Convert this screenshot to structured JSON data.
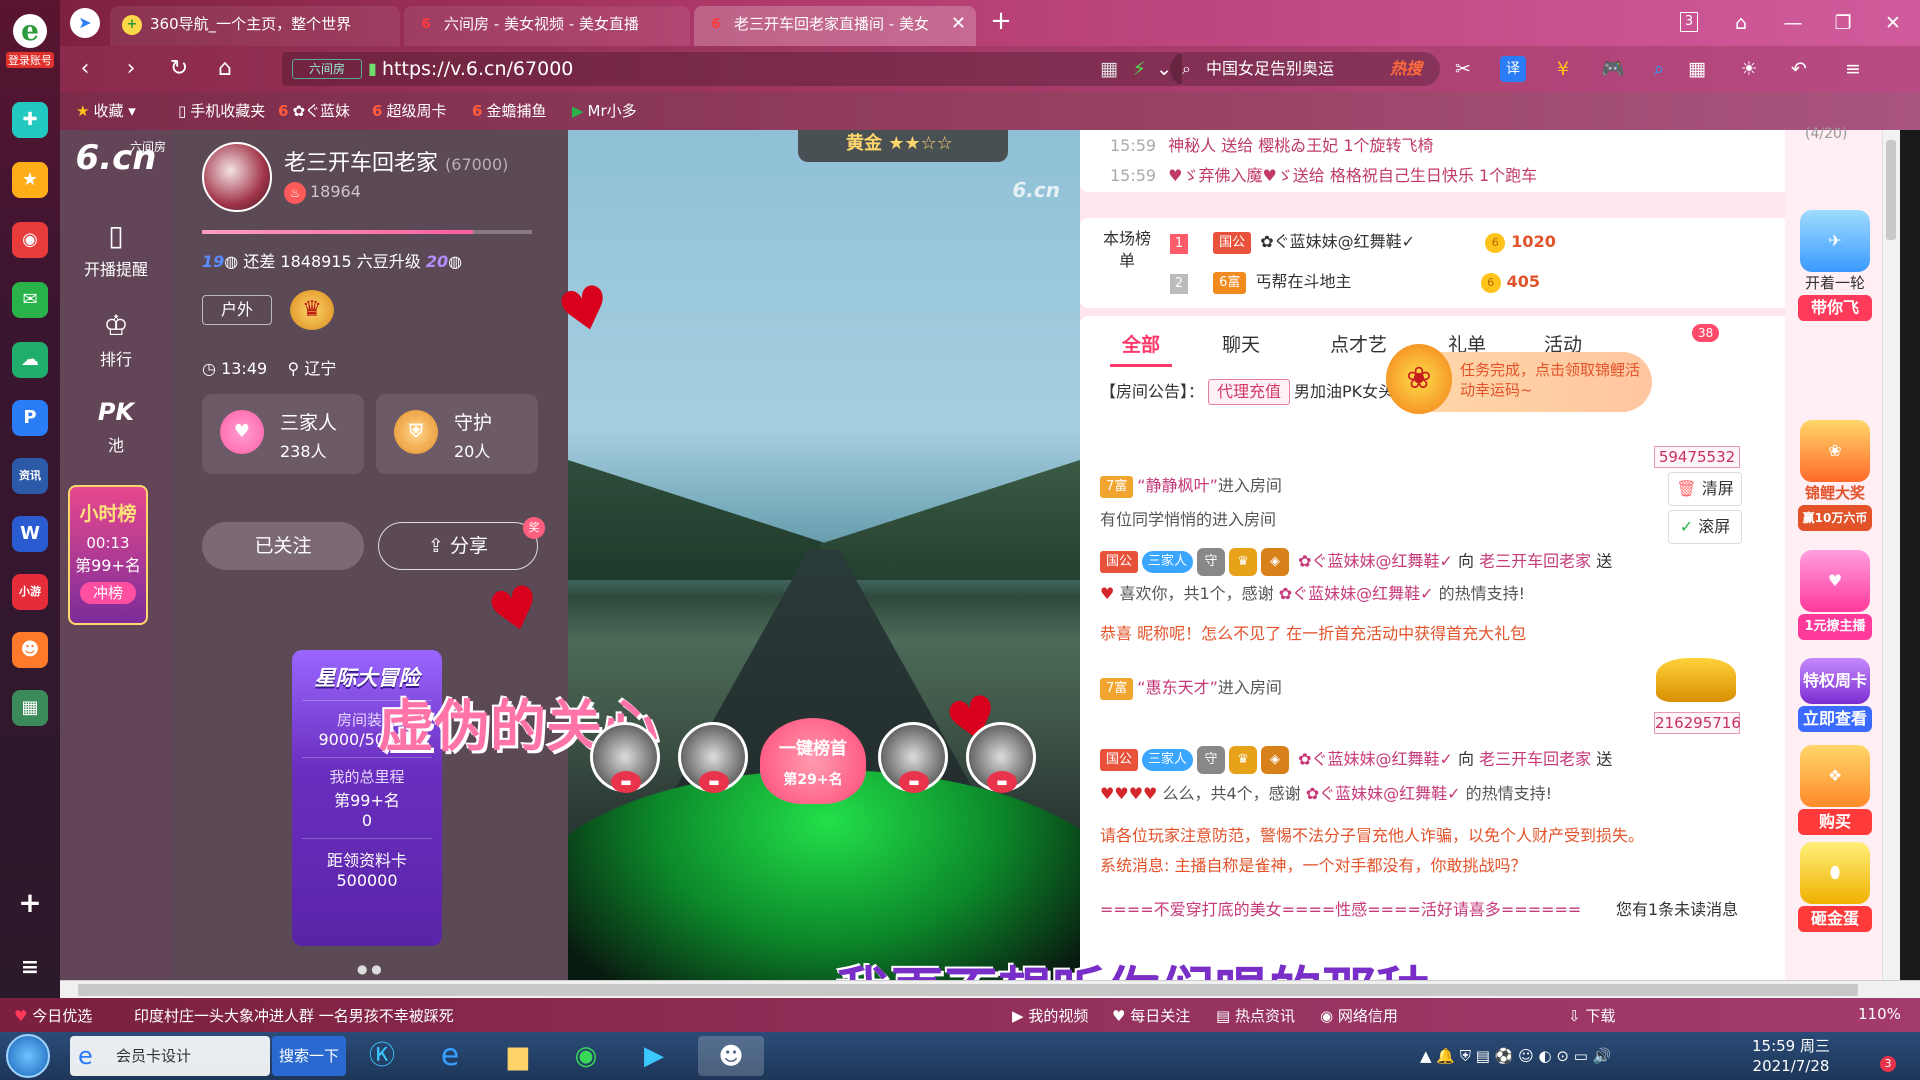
{
  "browser": {
    "tabs": [
      {
        "label": "360导航_一个主页，整个世界",
        "icon": "360-icon"
      },
      {
        "label": "六间房 - 美女视频 - 美女直播",
        "icon": "6room-icon"
      },
      {
        "label": "老三开车回老家直播间 - 美女",
        "icon": "6room-icon"
      }
    ],
    "account_label": "登录账号",
    "tab_counter": "3",
    "url": "https://v.6.cn/67000",
    "site_tag": "六间房",
    "search_text": "中国女足告别奥运",
    "search_hot": "热搜",
    "bookmarks": [
      "收藏",
      "手机收藏夹",
      "ぐ蓝妹",
      "超级周卡",
      "金蟾捕鱼",
      "Mr小多"
    ]
  },
  "sidebar_nav": [
    {
      "label": "6.cn",
      "sub": "六间房"
    },
    {
      "label": "开播提醒"
    },
    {
      "label": "排行"
    },
    {
      "label": "PK",
      "sub": "池"
    }
  ],
  "host": {
    "name": "老三开车回老家",
    "id": "(67000)",
    "fans": "18964",
    "level_from": "19",
    "level_to": "20",
    "level_text": "还差 1848915 六豆升级",
    "tag": "户外",
    "time": "13:49",
    "location": "辽宁",
    "family_label": "三家人",
    "family_count": "238人",
    "guard_label": "守护",
    "guard_count": "20人",
    "follow_label": "已关注",
    "share_label": "分享"
  },
  "hour_rank": {
    "title": "小时榜",
    "time": "00:13",
    "rank": "第99+名",
    "button": "冲榜"
  },
  "adventure": {
    "title": "星际大冒险",
    "deco_label": "房间装扮",
    "deco_value": "9000/50000",
    "mileage_label": "我的总里程",
    "mileage_rank": "第99+名",
    "mileage_value": "0",
    "card_label": "距领资料卡",
    "card_value": "500000"
  },
  "video": {
    "watermark": "6.cn",
    "vip_label": "黄金",
    "subtitle_1": "虚伪的关心",
    "subtitle_2": "我再不想听你们唱的那种",
    "onekey_label": "一键榜首",
    "onekey_rank": "第29+名"
  },
  "gift_feed": [
    {
      "time": "15:59",
      "text": "神秘人 送给 樱桃ゐ王妃 1个旋转飞椅"
    },
    {
      "time": "15:59",
      "text": "♥ゞ弃佛入魔♥ゞ送给 格格祝自己生日快乐 1个跑车"
    }
  ],
  "room_rank": {
    "label": "本场榜单",
    "rows": [
      {
        "num": "1",
        "badge": "国公",
        "name": "✿ぐ蓝妹妹@红舞鞋✓",
        "score": "1020"
      },
      {
        "num": "2",
        "badge": "6富",
        "name": "丐帮在斗地主",
        "score": "405"
      }
    ]
  },
  "chat": {
    "tabs": [
      "全部",
      "聊天",
      "点才艺",
      "礼单",
      "活动"
    ],
    "badge_count": "38",
    "notice_label": "【房间公告】：",
    "notice_btn": "代理充值",
    "notice_text": "男加油PK女头条 守护300 库存超",
    "clear_btn": "清屏",
    "scroll_btn": "滚屏",
    "messages": [
      {
        "id": "num1",
        "text": "59475532"
      },
      {
        "id": "m1",
        "badge": "7富",
        "name": "“静静枫叶”",
        "text": "进入房间"
      },
      {
        "id": "m2",
        "text": "有位同学悄悄的进入房间"
      },
      {
        "id": "m3",
        "badge": "国公",
        "fam": "三家人",
        "name": "✿ぐ蓝妹妹@红舞鞋✓",
        "to": "向",
        "host": "老三开车回老家",
        "act": "送"
      },
      {
        "id": "m4",
        "text": "喜欢你，共1个，感谢",
        "name": "✿ぐ蓝妹妹@红舞鞋✓",
        "tail": "的热情支持!"
      },
      {
        "id": "m5",
        "text": "恭喜 昵称呢！怎么不见了 在一折首充活动中获得首充大礼包"
      },
      {
        "id": "m6",
        "badge": "7富",
        "name": "“惠东天才”",
        "text": "进入房间"
      },
      {
        "id": "num2",
        "text": "216295716"
      },
      {
        "id": "m7",
        "badge": "国公",
        "fam": "三家人",
        "name": "✿ぐ蓝妹妹@红舞鞋✓",
        "to": "向",
        "host": "老三开车回老家",
        "act": "送"
      },
      {
        "id": "m8",
        "text": "么么，共4个，感谢",
        "name": "✿ぐ蓝妹妹@红舞鞋✓",
        "tail": "的热情支持!"
      },
      {
        "id": "m9",
        "text": "请各位玩家注意防范，警惕不法分子冒充他人诈骗，以免个人财产受到损失。"
      },
      {
        "id": "m10",
        "text": "系统消息: 主播自称是雀神，一个对手都没有，你敢挑战吗？"
      }
    ],
    "unread": "您有1条未读消息",
    "marquee": "====不爱穿打底的美女====性感====活好请喜多======"
  },
  "task_tip": "任务完成，点击领取锦鲤活动幸运码~",
  "right_col": [
    {
      "label": "开着一轮",
      "btn": "带你飞"
    },
    {
      "label": "锦鲤大奖",
      "btn": "赢10万六币"
    },
    {
      "label": "1元撩主播",
      "btn": ""
    },
    {
      "label": "特权周卡",
      "btn": "立即查看"
    },
    {
      "label": "",
      "btn": "购买"
    },
    {
      "label": "",
      "btn": "砸金蛋"
    }
  ],
  "right_col_extra": "(4/20)",
  "status_bar": {
    "left": "今日优选",
    "news": "印度村庄一头大象冲进人群 一名男孩不幸被踩死",
    "items": [
      "我的视频",
      "每日关注",
      "热点资讯",
      "网络信用",
      "下载"
    ],
    "zoom": "110%"
  },
  "taskbar": {
    "app1": "会员卡设计",
    "search_btn": "搜索一下",
    "time": "15:59 周三",
    "date": "2021/7/28",
    "badge": "3"
  }
}
